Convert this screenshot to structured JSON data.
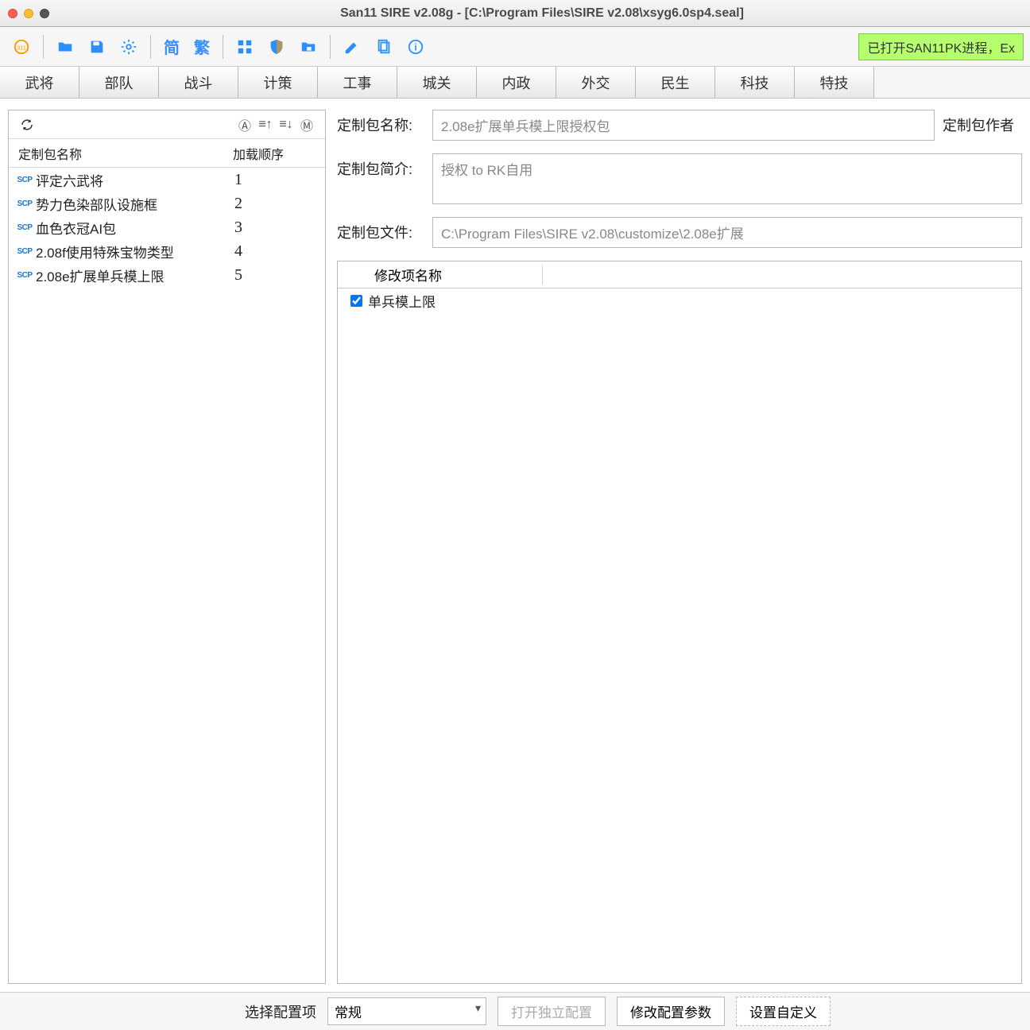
{
  "window": {
    "title": "San11 SIRE v2.08g - [C:\\Program Files\\SIRE v2.08\\xsyg6.0sp4.seal]"
  },
  "toolbar": {
    "simp": "简",
    "trad": "繁",
    "status": "已打开SAN11PK进程，Ex"
  },
  "tabs": [
    "武将",
    "部队",
    "战斗",
    "计策",
    "工事",
    "城关",
    "内政",
    "外交",
    "民生",
    "科技",
    "特技"
  ],
  "leftPane": {
    "header": {
      "name": "定制包名称",
      "order": "加载顺序"
    },
    "rows": [
      {
        "name": "评定六武将",
        "order": "1"
      },
      {
        "name": "势力色染部队设施框",
        "order": "2"
      },
      {
        "name": "血色衣冠AI包",
        "order": "3"
      },
      {
        "name": "2.08f使用特殊宝物类型",
        "order": "4"
      },
      {
        "name": "2.08e扩展单兵模上限",
        "order": "5"
      }
    ]
  },
  "form": {
    "nameLabel": "定制包名称:",
    "nameValue": "2.08e扩展单兵模上限授权包",
    "sideLabel": "定制包作者",
    "descLabel": "定制包简介:",
    "descValue": "授权 to RK自用",
    "fileLabel": "定制包文件:",
    "fileValue": "C:\\Program Files\\SIRE v2.08\\customize\\2.08e扩展"
  },
  "modTable": {
    "header": "修改项名称",
    "rows": [
      {
        "checked": true,
        "name": "单兵模上限"
      }
    ]
  },
  "footer": {
    "selectLabel": "选择配置项",
    "selectValue": "常规",
    "btnOpen": "打开独立配置",
    "btnModify": "修改配置参数",
    "btnCustom": "设置自定义"
  }
}
